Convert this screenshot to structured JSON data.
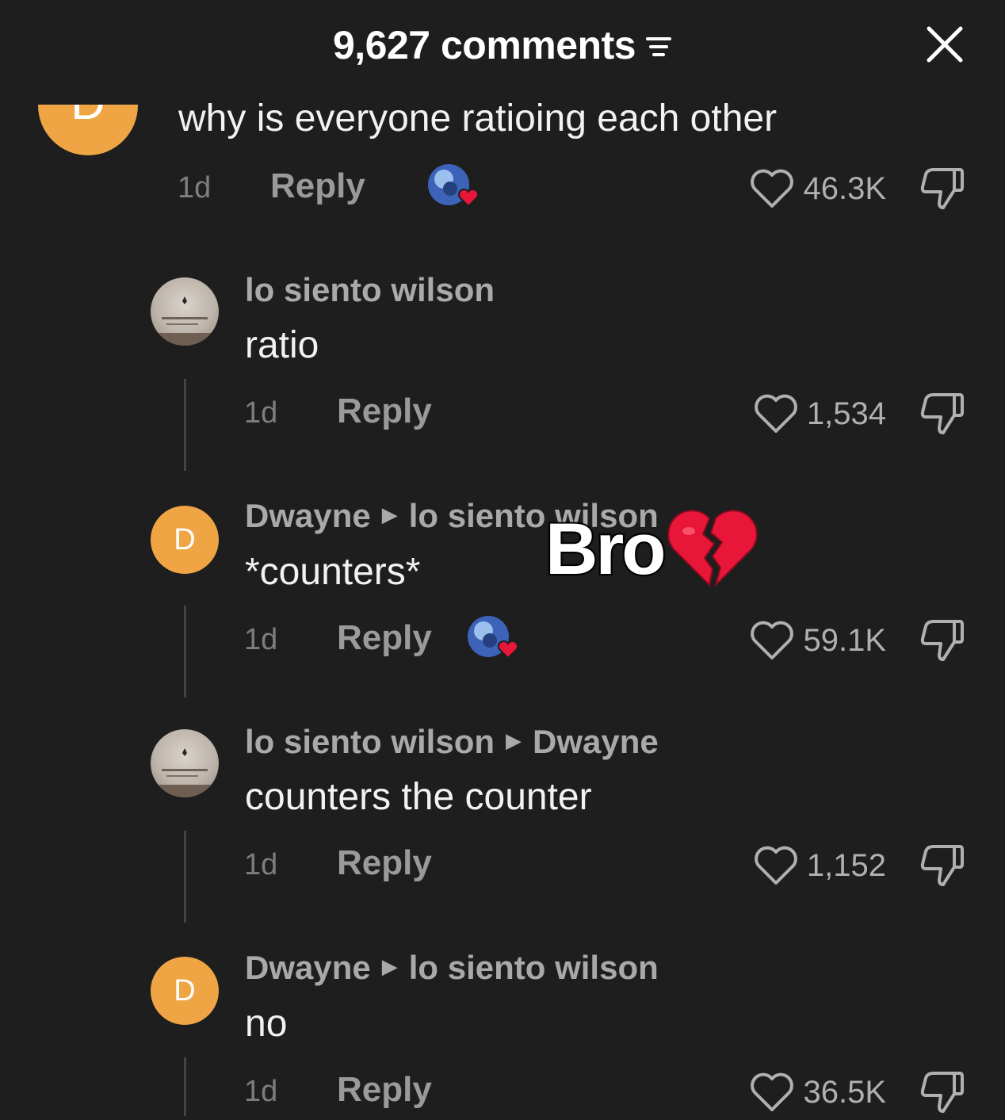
{
  "header": {
    "title": "9,627 comments"
  },
  "comments": [
    {
      "avatar_letter": "D",
      "text": "why is everyone ratioing each other",
      "time": "1d",
      "reply_label": "Reply",
      "likes": "46.3K",
      "creator_liked": true
    },
    {
      "username": "lo siento wilson",
      "text": "ratio",
      "time": "1d",
      "reply_label": "Reply",
      "likes": "1,534",
      "creator_liked": false
    },
    {
      "username": "Dwayne",
      "reply_to": "lo siento wilson",
      "avatar_letter": "D",
      "text": "*counters*",
      "time": "1d",
      "reply_label": "Reply",
      "likes": "59.1K",
      "creator_liked": true
    },
    {
      "username": "lo siento wilson",
      "reply_to": "Dwayne",
      "text": "counters the counter",
      "time": "1d",
      "reply_label": "Reply",
      "likes": "1,152",
      "creator_liked": false
    },
    {
      "username": "Dwayne",
      "reply_to": "lo siento wilson",
      "avatar_letter": "D",
      "text": "no",
      "time": "1d",
      "reply_label": "Reply",
      "likes": "36.5K",
      "creator_liked": false
    }
  ],
  "overlay": {
    "text": "Bro",
    "emoji": "broken-heart-icon"
  },
  "colors": {
    "background": "#1e1e1f",
    "avatar_orange": "#f0a545",
    "heart_red": "#e8173a"
  }
}
